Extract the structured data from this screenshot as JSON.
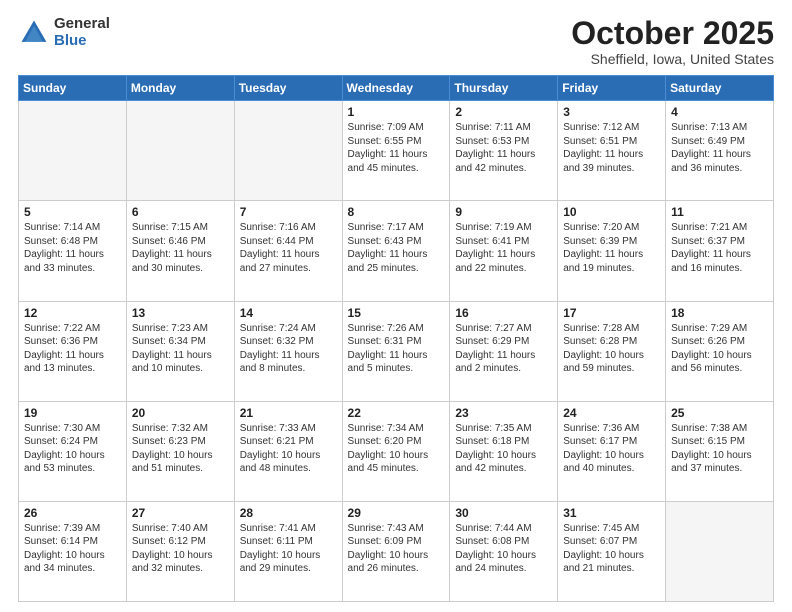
{
  "logo": {
    "general": "General",
    "blue": "Blue"
  },
  "header": {
    "month": "October 2025",
    "location": "Sheffield, Iowa, United States"
  },
  "days_of_week": [
    "Sunday",
    "Monday",
    "Tuesday",
    "Wednesday",
    "Thursday",
    "Friday",
    "Saturday"
  ],
  "weeks": [
    [
      {
        "day": "",
        "sunrise": "",
        "sunset": "",
        "daylight": "",
        "empty": true
      },
      {
        "day": "",
        "sunrise": "",
        "sunset": "",
        "daylight": "",
        "empty": true
      },
      {
        "day": "",
        "sunrise": "",
        "sunset": "",
        "daylight": "",
        "empty": true
      },
      {
        "day": "1",
        "sunrise": "Sunrise: 7:09 AM",
        "sunset": "Sunset: 6:55 PM",
        "daylight": "Daylight: 11 hours and 45 minutes.",
        "empty": false
      },
      {
        "day": "2",
        "sunrise": "Sunrise: 7:11 AM",
        "sunset": "Sunset: 6:53 PM",
        "daylight": "Daylight: 11 hours and 42 minutes.",
        "empty": false
      },
      {
        "day": "3",
        "sunrise": "Sunrise: 7:12 AM",
        "sunset": "Sunset: 6:51 PM",
        "daylight": "Daylight: 11 hours and 39 minutes.",
        "empty": false
      },
      {
        "day": "4",
        "sunrise": "Sunrise: 7:13 AM",
        "sunset": "Sunset: 6:49 PM",
        "daylight": "Daylight: 11 hours and 36 minutes.",
        "empty": false
      }
    ],
    [
      {
        "day": "5",
        "sunrise": "Sunrise: 7:14 AM",
        "sunset": "Sunset: 6:48 PM",
        "daylight": "Daylight: 11 hours and 33 minutes.",
        "empty": false
      },
      {
        "day": "6",
        "sunrise": "Sunrise: 7:15 AM",
        "sunset": "Sunset: 6:46 PM",
        "daylight": "Daylight: 11 hours and 30 minutes.",
        "empty": false
      },
      {
        "day": "7",
        "sunrise": "Sunrise: 7:16 AM",
        "sunset": "Sunset: 6:44 PM",
        "daylight": "Daylight: 11 hours and 27 minutes.",
        "empty": false
      },
      {
        "day": "8",
        "sunrise": "Sunrise: 7:17 AM",
        "sunset": "Sunset: 6:43 PM",
        "daylight": "Daylight: 11 hours and 25 minutes.",
        "empty": false
      },
      {
        "day": "9",
        "sunrise": "Sunrise: 7:19 AM",
        "sunset": "Sunset: 6:41 PM",
        "daylight": "Daylight: 11 hours and 22 minutes.",
        "empty": false
      },
      {
        "day": "10",
        "sunrise": "Sunrise: 7:20 AM",
        "sunset": "Sunset: 6:39 PM",
        "daylight": "Daylight: 11 hours and 19 minutes.",
        "empty": false
      },
      {
        "day": "11",
        "sunrise": "Sunrise: 7:21 AM",
        "sunset": "Sunset: 6:37 PM",
        "daylight": "Daylight: 11 hours and 16 minutes.",
        "empty": false
      }
    ],
    [
      {
        "day": "12",
        "sunrise": "Sunrise: 7:22 AM",
        "sunset": "Sunset: 6:36 PM",
        "daylight": "Daylight: 11 hours and 13 minutes.",
        "empty": false
      },
      {
        "day": "13",
        "sunrise": "Sunrise: 7:23 AM",
        "sunset": "Sunset: 6:34 PM",
        "daylight": "Daylight: 11 hours and 10 minutes.",
        "empty": false
      },
      {
        "day": "14",
        "sunrise": "Sunrise: 7:24 AM",
        "sunset": "Sunset: 6:32 PM",
        "daylight": "Daylight: 11 hours and 8 minutes.",
        "empty": false
      },
      {
        "day": "15",
        "sunrise": "Sunrise: 7:26 AM",
        "sunset": "Sunset: 6:31 PM",
        "daylight": "Daylight: 11 hours and 5 minutes.",
        "empty": false
      },
      {
        "day": "16",
        "sunrise": "Sunrise: 7:27 AM",
        "sunset": "Sunset: 6:29 PM",
        "daylight": "Daylight: 11 hours and 2 minutes.",
        "empty": false
      },
      {
        "day": "17",
        "sunrise": "Sunrise: 7:28 AM",
        "sunset": "Sunset: 6:28 PM",
        "daylight": "Daylight: 10 hours and 59 minutes.",
        "empty": false
      },
      {
        "day": "18",
        "sunrise": "Sunrise: 7:29 AM",
        "sunset": "Sunset: 6:26 PM",
        "daylight": "Daylight: 10 hours and 56 minutes.",
        "empty": false
      }
    ],
    [
      {
        "day": "19",
        "sunrise": "Sunrise: 7:30 AM",
        "sunset": "Sunset: 6:24 PM",
        "daylight": "Daylight: 10 hours and 53 minutes.",
        "empty": false
      },
      {
        "day": "20",
        "sunrise": "Sunrise: 7:32 AM",
        "sunset": "Sunset: 6:23 PM",
        "daylight": "Daylight: 10 hours and 51 minutes.",
        "empty": false
      },
      {
        "day": "21",
        "sunrise": "Sunrise: 7:33 AM",
        "sunset": "Sunset: 6:21 PM",
        "daylight": "Daylight: 10 hours and 48 minutes.",
        "empty": false
      },
      {
        "day": "22",
        "sunrise": "Sunrise: 7:34 AM",
        "sunset": "Sunset: 6:20 PM",
        "daylight": "Daylight: 10 hours and 45 minutes.",
        "empty": false
      },
      {
        "day": "23",
        "sunrise": "Sunrise: 7:35 AM",
        "sunset": "Sunset: 6:18 PM",
        "daylight": "Daylight: 10 hours and 42 minutes.",
        "empty": false
      },
      {
        "day": "24",
        "sunrise": "Sunrise: 7:36 AM",
        "sunset": "Sunset: 6:17 PM",
        "daylight": "Daylight: 10 hours and 40 minutes.",
        "empty": false
      },
      {
        "day": "25",
        "sunrise": "Sunrise: 7:38 AM",
        "sunset": "Sunset: 6:15 PM",
        "daylight": "Daylight: 10 hours and 37 minutes.",
        "empty": false
      }
    ],
    [
      {
        "day": "26",
        "sunrise": "Sunrise: 7:39 AM",
        "sunset": "Sunset: 6:14 PM",
        "daylight": "Daylight: 10 hours and 34 minutes.",
        "empty": false
      },
      {
        "day": "27",
        "sunrise": "Sunrise: 7:40 AM",
        "sunset": "Sunset: 6:12 PM",
        "daylight": "Daylight: 10 hours and 32 minutes.",
        "empty": false
      },
      {
        "day": "28",
        "sunrise": "Sunrise: 7:41 AM",
        "sunset": "Sunset: 6:11 PM",
        "daylight": "Daylight: 10 hours and 29 minutes.",
        "empty": false
      },
      {
        "day": "29",
        "sunrise": "Sunrise: 7:43 AM",
        "sunset": "Sunset: 6:09 PM",
        "daylight": "Daylight: 10 hours and 26 minutes.",
        "empty": false
      },
      {
        "day": "30",
        "sunrise": "Sunrise: 7:44 AM",
        "sunset": "Sunset: 6:08 PM",
        "daylight": "Daylight: 10 hours and 24 minutes.",
        "empty": false
      },
      {
        "day": "31",
        "sunrise": "Sunrise: 7:45 AM",
        "sunset": "Sunset: 6:07 PM",
        "daylight": "Daylight: 10 hours and 21 minutes.",
        "empty": false
      },
      {
        "day": "",
        "sunrise": "",
        "sunset": "",
        "daylight": "",
        "empty": true
      }
    ]
  ]
}
